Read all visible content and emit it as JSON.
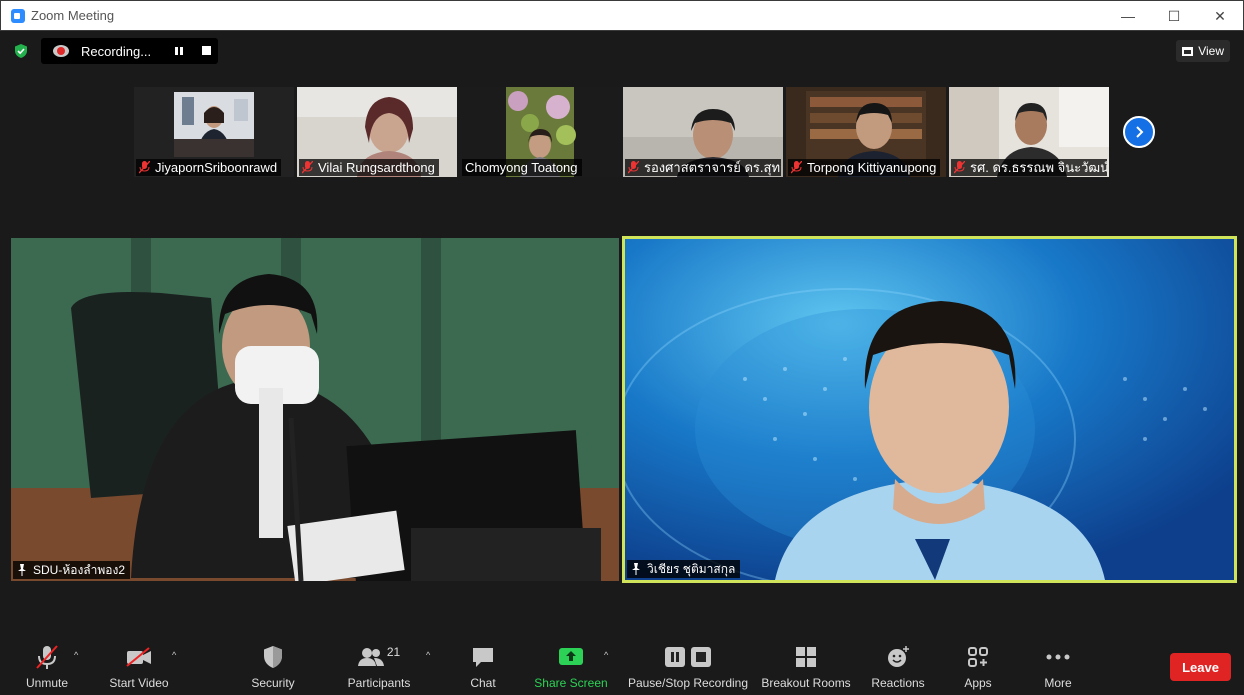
{
  "window": {
    "title": "Zoom Meeting",
    "minimize": "—",
    "maximize": "☐",
    "close": "✕"
  },
  "topbar": {
    "recording_label": "Recording...",
    "view_label": "View"
  },
  "thumbnails": [
    {
      "name": "JiyapornSriboonrawd"
    },
    {
      "name": "Vilai Rungsardthong"
    },
    {
      "name": "Chomyong Toatong"
    },
    {
      "name": "รองศาสตราจารย์ ดร.สุทธิ..."
    },
    {
      "name": "Torpong Kittiyanupong"
    },
    {
      "name": "รศ. ดร.ธรรณพ จินะวัฒน์"
    }
  ],
  "main": {
    "left_name": "SDU-ห้องลำพอง2",
    "right_name": "วิเชียร ชุติมาสกุล"
  },
  "toolbar": {
    "unmute": "Unmute",
    "start_video": "Start Video",
    "security": "Security",
    "participants": "Participants",
    "participants_count": "21",
    "chat": "Chat",
    "share_screen": "Share Screen",
    "pause_stop_recording": "Pause/Stop Recording",
    "breakout_rooms": "Breakout Rooms",
    "reactions": "Reactions",
    "apps": "Apps",
    "more": "More",
    "leave": "Leave"
  },
  "colors": {
    "share_green": "#2bd255",
    "leave_red": "#e02424",
    "active_speaker": "#cfe35b",
    "next_blue": "#1570e6"
  }
}
